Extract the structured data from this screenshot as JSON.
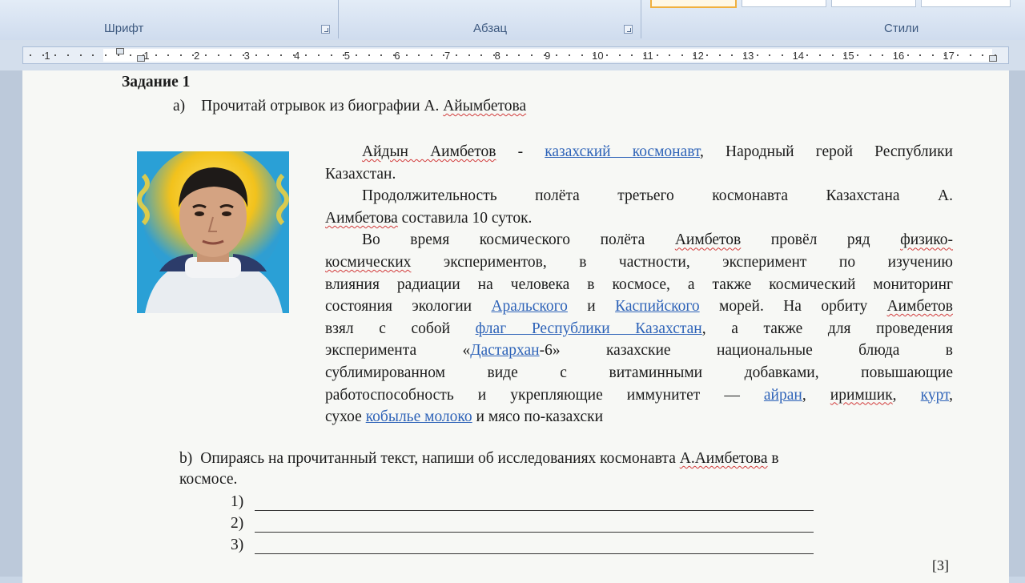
{
  "ribbon": {
    "font_group_label": "Шрифт",
    "paragraph_group_label": "Абзац",
    "styles_group_label": "Стили"
  },
  "ruler": {
    "numbers": [
      "1",
      "1",
      "2",
      "3",
      "4",
      "5",
      "6",
      "7",
      "8",
      "9",
      "10",
      "11",
      "12",
      "13",
      "14",
      "15",
      "16",
      "17"
    ]
  },
  "document": {
    "task_title": "Задание 1",
    "part_a": {
      "marker": "а)",
      "text_before": "Прочитай отрывок из биографии А. ",
      "text_squig": "Айымбетова"
    },
    "bio": {
      "p1_name": "Айдын Аимбетов",
      "p1_dash": " - ",
      "p1_link": "казахский космонавт",
      "p1_rest": ", Народный герой Республики",
      "p1_line2": "Казахстан.",
      "p2_line1": "Продолжительность полёта третьего космонавта Казахстана А.",
      "p2_line2_squig": "Аимбетова",
      "p2_line2_rest": " составила 10 суток.",
      "p3_l1_a": "Во время космического полёта ",
      "p3_l1_squig": "Аимбетов",
      "p3_l1_b": " провёл ряд ",
      "p3_l1_squig2": "физико-",
      "p3_l2_squig": "космических",
      "p3_l2_rest": " экспериментов, в частности, эксперимент по изучению",
      "p3_l3": "влияния радиации на человека в космосе, а также космический мониторинг",
      "p3_l4_a": "состояния экологии ",
      "p3_l4_link1": "Аральского",
      "p3_l4_b": " и ",
      "p3_l4_link2": "Каспийского",
      "p3_l4_c": " морей. На орбиту ",
      "p3_l4_squig": "Аимбетов",
      "p3_l5_a": "взял с собой ",
      "p3_l5_link": "флаг Республики Казахстан",
      "p3_l5_b": ", а также для проведения",
      "p3_l6_a": "эксперимента «",
      "p3_l6_link": "Дастархан",
      "p3_l6_b": "-6» казахские национальные блюда в",
      "p3_l7": "сублимированном виде с витаминными добавками, повышающие",
      "p3_l8_a": "работоспособность и укрепляющие иммунитет — ",
      "p3_l8_link1": "айран",
      "p3_l8_b": ", ",
      "p3_l8_squig": "иримшик",
      "p3_l8_c": ", ",
      "p3_l8_link2": "курт",
      "p3_l8_d": ",",
      "p3_l9_a": "сухое ",
      "p3_l9_link": "кобылье молоко",
      "p3_l9_b": " и мясо по-казахски"
    },
    "part_b": {
      "marker": "b)",
      "line1_before": "Опираясь на прочитанный текст, напиши об исследованиях космонавта ",
      "line1_squig": "А.Аимбетова",
      "line1_after": " в",
      "line2": "космосе."
    },
    "answers": [
      "1)",
      "2)",
      "3)"
    ],
    "score": "[3]"
  }
}
